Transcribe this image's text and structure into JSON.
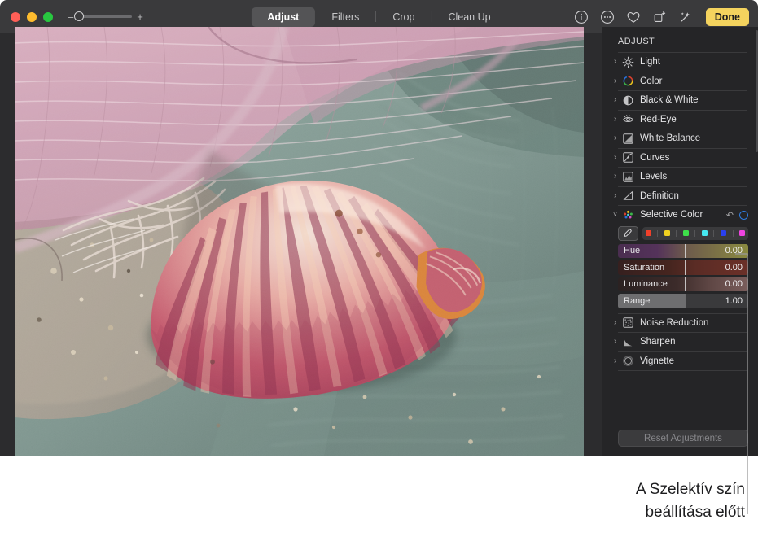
{
  "window": {
    "traffic_lights": [
      {
        "name": "close",
        "color": "#ff5f57"
      },
      {
        "name": "minimize",
        "color": "#febc2e"
      },
      {
        "name": "zoom",
        "color": "#28c840"
      }
    ]
  },
  "toolbar": {
    "zoom_out_label": "–",
    "zoom_in_label": "+",
    "tabs": [
      {
        "label": "Adjust",
        "selected": true
      },
      {
        "label": "Filters",
        "selected": false
      },
      {
        "label": "Crop",
        "selected": false
      },
      {
        "label": "Clean Up",
        "selected": false
      }
    ],
    "icons": [
      {
        "name": "info-icon"
      },
      {
        "name": "comment-icon"
      },
      {
        "name": "favorite-heart-icon"
      },
      {
        "name": "rotate-icon"
      },
      {
        "name": "auto-enhance-wand-icon"
      }
    ],
    "done_label": "Done",
    "done_color": "#f4d35e"
  },
  "panel": {
    "title": "ADJUST",
    "items": [
      {
        "label": "Light",
        "icon": "light-icon",
        "expanded": false
      },
      {
        "label": "Color",
        "icon": "color-wheel-icon",
        "expanded": false
      },
      {
        "label": "Black & White",
        "icon": "black-white-icon",
        "expanded": false
      },
      {
        "label": "Red-Eye",
        "icon": "red-eye-icon",
        "expanded": false
      },
      {
        "label": "White Balance",
        "icon": "white-balance-icon",
        "expanded": false
      },
      {
        "label": "Curves",
        "icon": "curves-icon",
        "expanded": false
      },
      {
        "label": "Levels",
        "icon": "levels-icon",
        "expanded": false
      },
      {
        "label": "Definition",
        "icon": "definition-icon",
        "expanded": false
      }
    ],
    "selective_color": {
      "label": "Selective Color",
      "icon": "selective-color-dots-icon",
      "expanded": true,
      "reset_icon": "reset-arrow-icon",
      "toggle_icon": "on-off-circle-icon",
      "toggle_color": "#2f7de0",
      "eyedropper_icon": "eyedropper-icon",
      "swatches": [
        {
          "name": "swatch-red",
          "color": "#f0402a"
        },
        {
          "name": "swatch-yellow",
          "color": "#f0d020"
        },
        {
          "name": "swatch-green",
          "color": "#3ee04a"
        },
        {
          "name": "swatch-cyan",
          "color": "#46e8f0"
        },
        {
          "name": "swatch-blue",
          "color": "#2a40f0"
        },
        {
          "name": "swatch-magenta",
          "color": "#ef44e0"
        }
      ],
      "sliders": [
        {
          "label": "Hue",
          "value": "0.00",
          "knob_pct": 51,
          "from": "#4a2e50",
          "to": "#8a8a40"
        },
        {
          "label": "Saturation",
          "value": "0.00",
          "knob_pct": 51,
          "from": "#3b2220",
          "to": "#6b3028"
        },
        {
          "label": "Luminance",
          "value": "0.00",
          "knob_pct": 51,
          "from": "#2e2424",
          "to": "#7a5e5c"
        },
        {
          "label": "Range",
          "value": "1.00",
          "fill_pct": 52
        }
      ]
    },
    "items_after": [
      {
        "label": "Noise Reduction",
        "icon": "noise-reduction-icon",
        "expanded": false
      },
      {
        "label": "Sharpen",
        "icon": "sharpen-icon",
        "expanded": false
      },
      {
        "label": "Vignette",
        "icon": "vignette-icon",
        "expanded": false
      }
    ],
    "reset_button_label": "Reset Adjustments"
  },
  "caption": {
    "line1": "A Szelektív szín",
    "line2": "beállítása előtt"
  }
}
